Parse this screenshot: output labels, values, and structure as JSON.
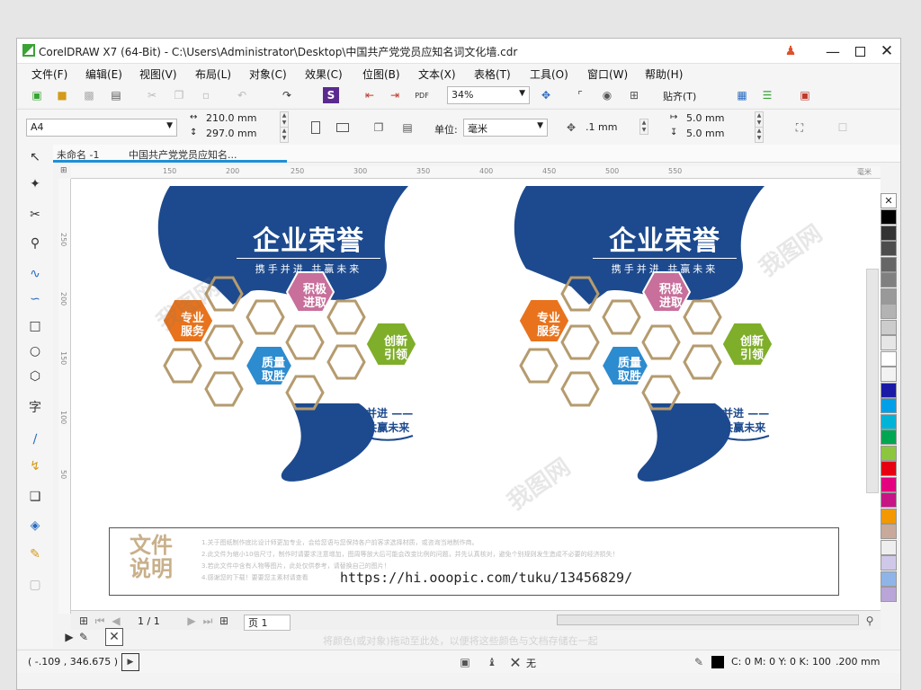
{
  "window": {
    "title": "CorelDRAW X7 (64-Bit) - C:\\Users\\Administrator\\Desktop\\中国共产党党员应知名词文化墙.cdr"
  },
  "menus": [
    "文件(F)",
    "编辑(E)",
    "视图(V)",
    "布局(L)",
    "对象(C)",
    "效果(C)",
    "位图(B)",
    "文本(X)",
    "表格(T)",
    "工具(O)",
    "窗口(W)",
    "帮助(H)"
  ],
  "toolbar": {
    "zoom": "34%",
    "snap_label": "贴齐(T)"
  },
  "property_bar": {
    "page_size": "A4",
    "width": "210.0 mm",
    "height": "297.0 mm",
    "units_label": "单位:",
    "units_value": "毫米",
    "nudge": ".1 mm",
    "dup_x": "5.0 mm",
    "dup_y": "5.0 mm"
  },
  "tabs": [
    "未命名 -1",
    "中国共产党党员应知名..."
  ],
  "ruler_h": [
    "150",
    "200",
    "250",
    "300",
    "350",
    "400",
    "450",
    "500",
    "550",
    "毫米"
  ],
  "ruler_v": [
    "250",
    "200",
    "150",
    "100",
    "50"
  ],
  "design": {
    "title": "企业荣誉",
    "subtitle": "携手并进 共赢未来",
    "hex_labels": {
      "orange": "专业\n服务",
      "pink": "积极\n进取",
      "blue": "质量\n取胜",
      "green": "创新\n引领"
    },
    "slogan_1": "携手并进",
    "slogan_2": "共赢未来"
  },
  "note_box": {
    "heading_1": "文件",
    "heading_2": "说明",
    "lines": [
      "1.关于图纸制作底比设计师更加专业，会给您语与您保持各户前客求选择材质，或咨询当地制作商。",
      "2.此文件为缩小10倍尺寸，制作时请要求注意增加，图周等放大后可能会改变比例的问题，并先认真核对，避免个别规则发生造成不必要的经济损失！",
      "3.若此文件中含有人物等图片，此处仅供参考，请替换自己的图片！",
      "4.感谢您的下载！要要您主素材请查看"
    ],
    "url": "https://hi.ooopic.com/tuku/13456829/"
  },
  "page_nav": {
    "counter": "1 / 1",
    "page_tab": "页 1"
  },
  "status": {
    "coords": "( -.109 , 346.675 )",
    "fill_label": "无",
    "color_info": "C: 0 M: 0 Y: 0 K: 100",
    "stroke_width": ".200 mm",
    "hint": "将颜色(或对象)拖动至此处，以便将这些颜色与文档存储在一起"
  },
  "watermark": "我图网",
  "colors": {
    "navy": "#1d4a8e",
    "orange": "#e8731c",
    "pink": "#c86f9b",
    "blue": "#2d8bcf",
    "green": "#7fae2a",
    "gold": "#b59b6e",
    "note_title": "#c8b08a"
  },
  "palette": [
    "#000000",
    "#333333",
    "#4d4d4d",
    "#666666",
    "#808080",
    "#999999",
    "#b3b3b3",
    "#cccccc",
    "#e6e6e6",
    "#ffffff",
    "#f2f2f2",
    "#1a1aa6",
    "#00a0e9",
    "#00b4d8",
    "#00a651",
    "#8cc63f",
    "#e60012",
    "#e4007f",
    "#c71585",
    "#f39800",
    "#c9a99a",
    "#eeeeee",
    "#d0c8e8",
    "#8fb4e8",
    "#b9a5d8"
  ]
}
